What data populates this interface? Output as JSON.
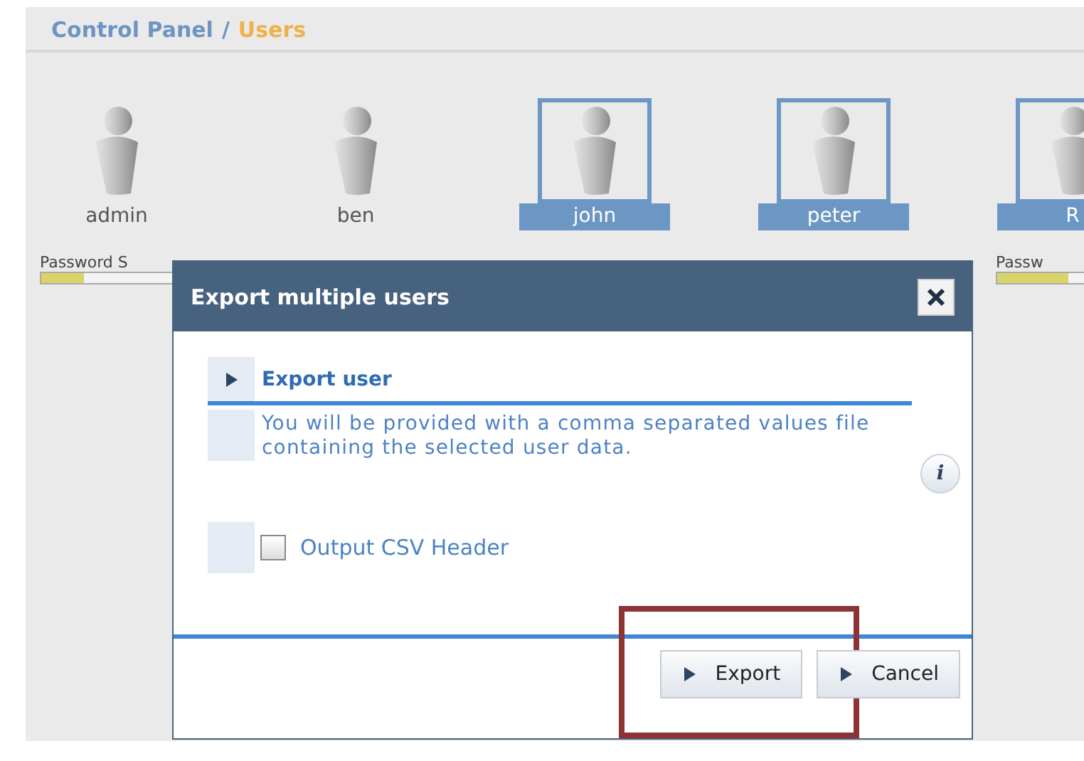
{
  "breadcrumb": {
    "parent": "Control Panel",
    "separator": "/",
    "current": "Users"
  },
  "users": [
    {
      "name": "admin",
      "selected": false,
      "password_strength": {
        "label": "Password S",
        "level": 0.3
      }
    },
    {
      "name": "ben",
      "selected": false
    },
    {
      "name": "john",
      "selected": true
    },
    {
      "name": "peter",
      "selected": true
    },
    {
      "name": "R",
      "selected": true,
      "password_strength": {
        "label": "Passw",
        "level": 0.5
      }
    }
  ],
  "dialog": {
    "title": "Export multiple users",
    "section_title": "Export user",
    "description": "You will be provided with a comma separated values file containing the selected user data.",
    "info_button": "i",
    "option": {
      "label": "Output CSV Header",
      "checked": false
    },
    "buttons": [
      {
        "label": "Export",
        "highlighted": true
      },
      {
        "label": "Cancel",
        "highlighted": false
      }
    ]
  }
}
